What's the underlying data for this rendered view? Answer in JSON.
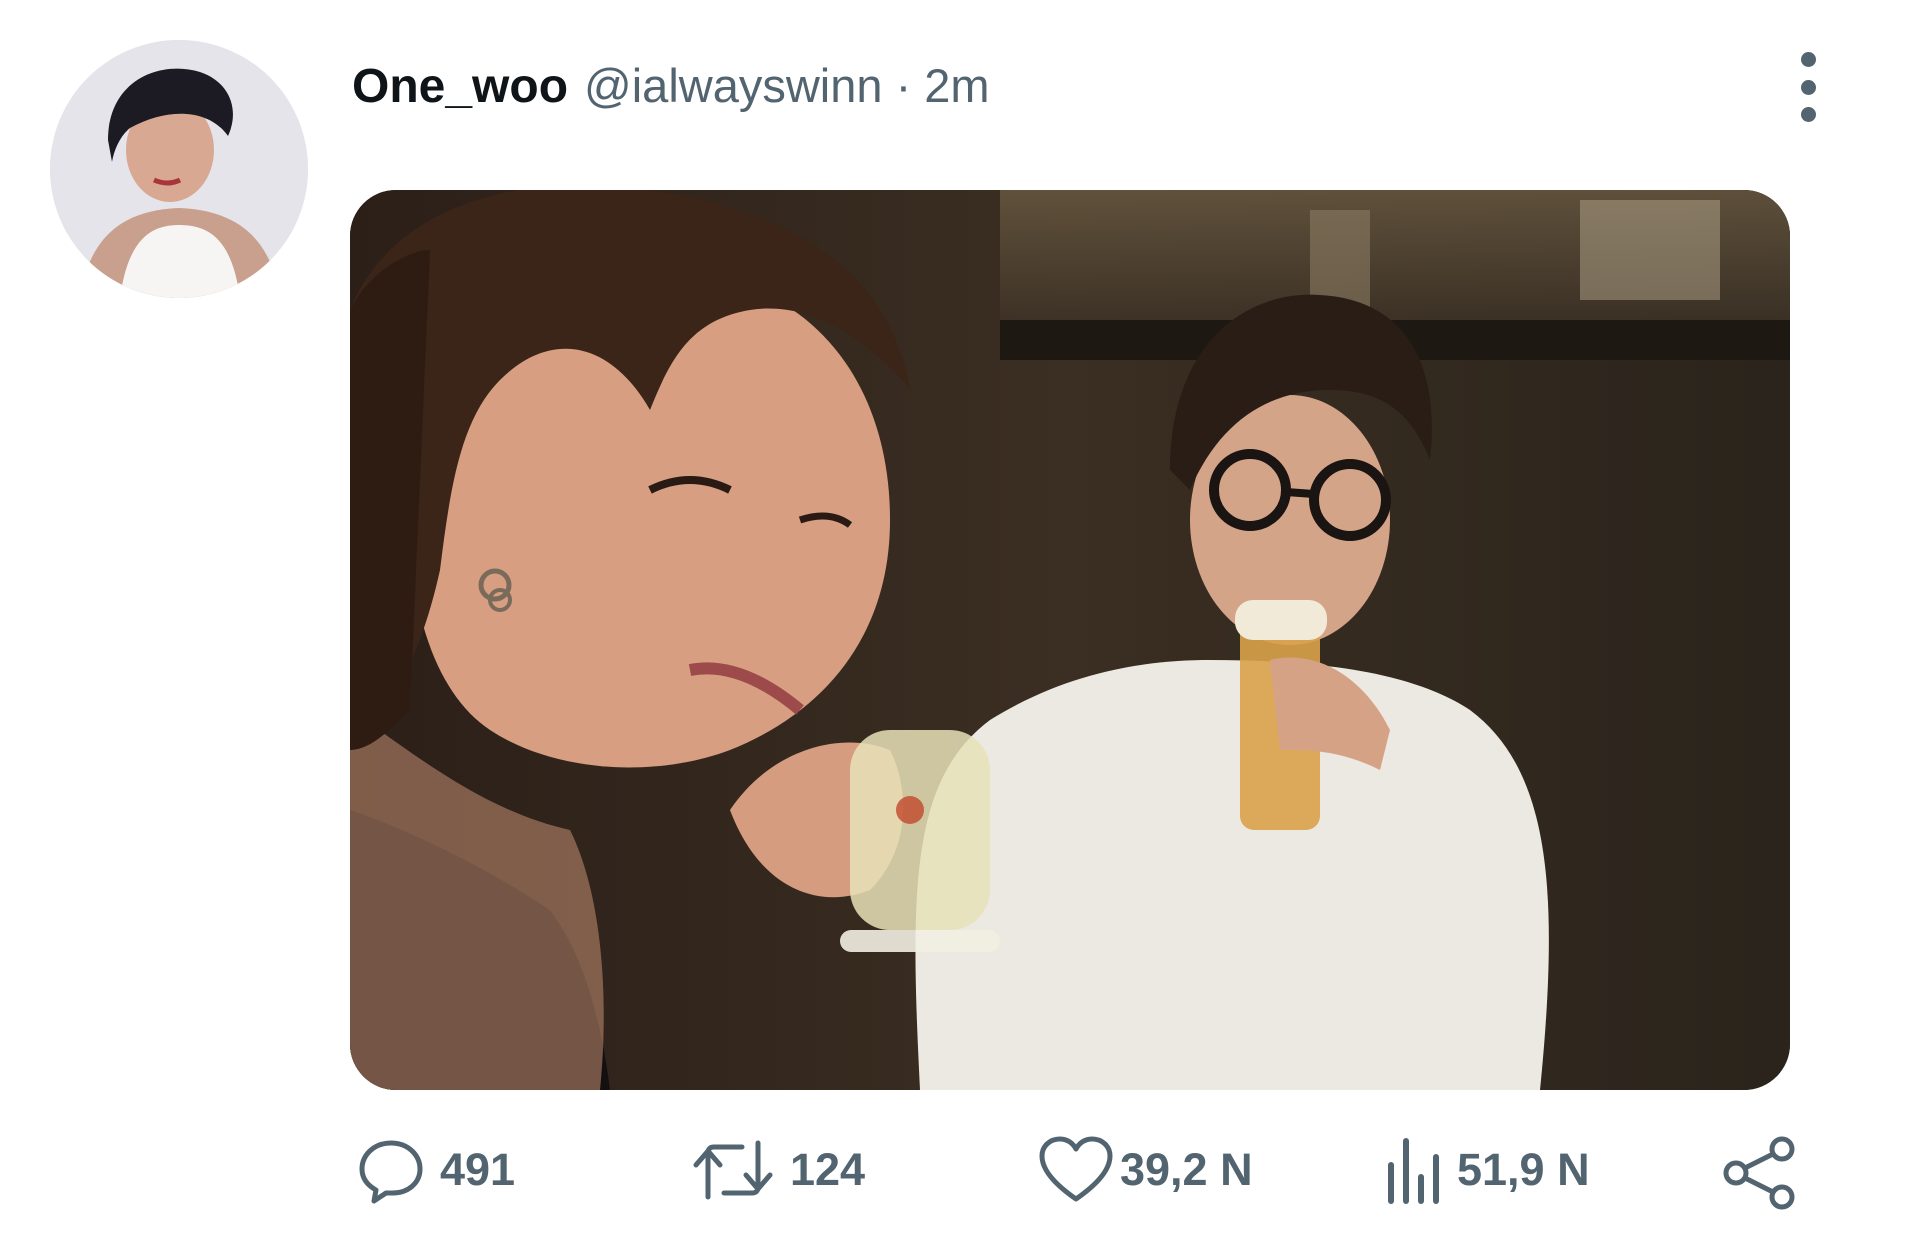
{
  "post": {
    "display_name": "One_woo",
    "handle_time": "@ialwayswinn · 2m"
  },
  "actions": {
    "reply_count": "491",
    "repost_count": "124",
    "like_count": "39,2 N",
    "views_count": "51,9 N"
  },
  "icons": [
    "avatar",
    "more-icon",
    "reply-icon",
    "repost-icon",
    "like-icon",
    "views-icon",
    "share-icon"
  ],
  "colors": {
    "text": "#0f1419",
    "secondary": "#536471",
    "background": "#ffffff"
  }
}
